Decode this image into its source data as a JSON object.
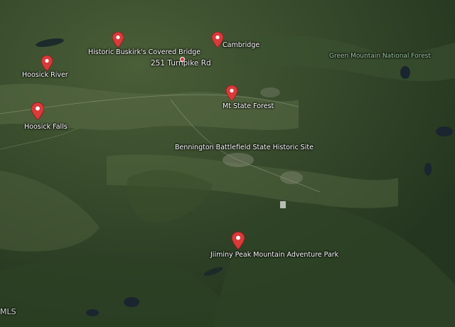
{
  "places": [
    {
      "id": "hoosick-river",
      "label": "Hoosick River"
    },
    {
      "id": "historic-buskirk",
      "label": "Historic Buskirk's Covered Bridge"
    },
    {
      "id": "cambridge",
      "label": "Cambridge"
    },
    {
      "id": "mt-state-forest",
      "label": "Mt State Forest"
    },
    {
      "id": "hoosick-falls",
      "label": "Hoosick Falls"
    },
    {
      "id": "jiiminy-peak",
      "label": "Jiiminy Peak Mountain Adventure Park"
    }
  ],
  "road_label": "251 Turnpike Rd",
  "area_labels": {
    "bennington": "Bennington Battlefield State Historic Site",
    "green_mountain": "Green Mountain National Forest"
  },
  "watermark": "MLS",
  "colors": {
    "pin": "#d93a3a",
    "forest_label": "#9ec9a8"
  }
}
